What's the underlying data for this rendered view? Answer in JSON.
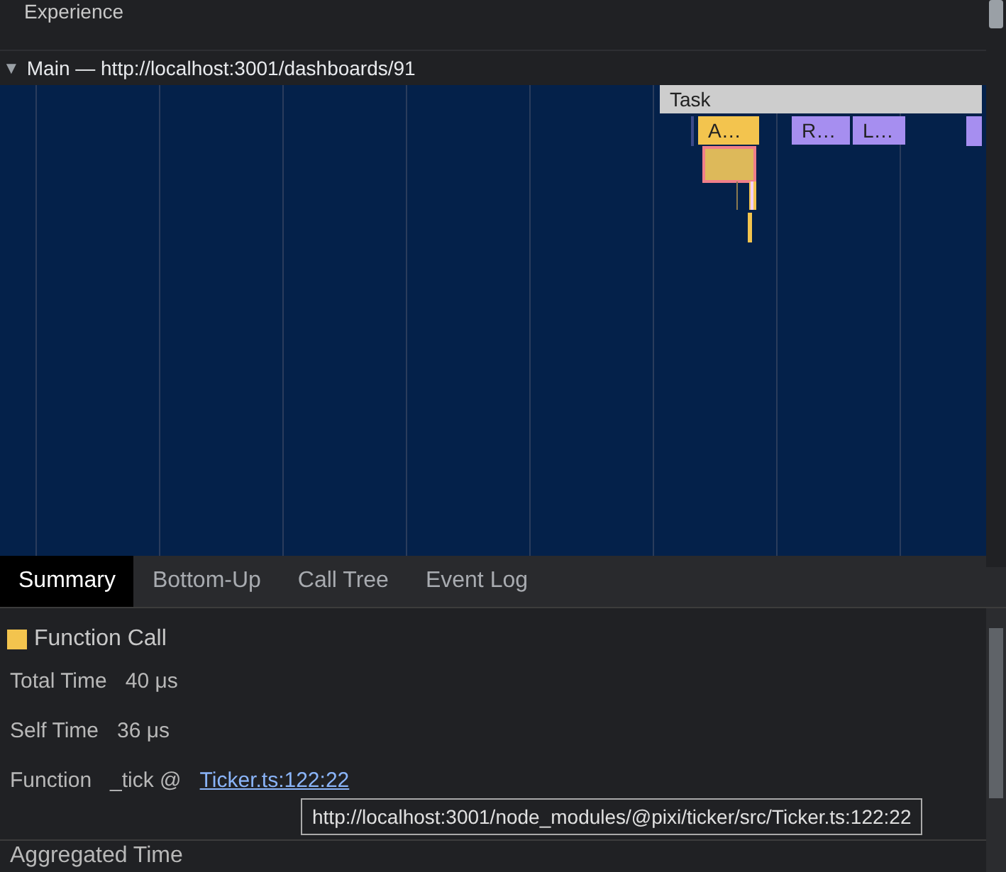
{
  "tracks": {
    "experience_label": "Experience",
    "main": {
      "toggle": "▼",
      "label": "Main — http://localhost:3001/dashboards/91",
      "expanded": true
    }
  },
  "flame": [
    {
      "label": "Task",
      "kind": "task"
    },
    {
      "label": "A…",
      "kind": "scripting"
    },
    {
      "label": "R…",
      "kind": "rendering"
    },
    {
      "label": "L…",
      "kind": "rendering"
    }
  ],
  "tabs": [
    {
      "label": "Summary",
      "selected": true
    },
    {
      "label": "Bottom-Up",
      "selected": false
    },
    {
      "label": "Call Tree",
      "selected": false
    },
    {
      "label": "Event Log",
      "selected": false
    }
  ],
  "summary": {
    "title": "Function Call",
    "color": "#f3c44e",
    "rows": [
      {
        "kind": "text",
        "label": "Total Time",
        "value": "40 μs"
      },
      {
        "kind": "text",
        "label": "Self Time",
        "value": "36 μs"
      },
      {
        "kind": "link",
        "label": "Function",
        "value": "_tick @",
        "link": "Ticker.ts:122:22"
      }
    ],
    "tooltip": "http://localhost:3001/node_modules/@pixi/ticker/src/Ticker.ts:122:22",
    "next_section": "Aggregated Time"
  }
}
